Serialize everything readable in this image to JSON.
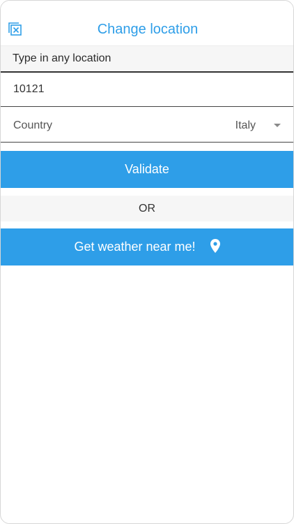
{
  "header": {
    "title": "Change location"
  },
  "form": {
    "hint": "Type in any location",
    "zip_value": "10121",
    "country_label": "Country",
    "country_value": "Italy"
  },
  "actions": {
    "validate_label": "Validate",
    "or_label": "OR",
    "near_me_label": "Get weather near me!"
  },
  "icons": {
    "close": "close-box-icon",
    "location": "map-pin-icon",
    "dropdown": "caret-down-icon"
  },
  "colors": {
    "accent": "#2e9ee8"
  }
}
